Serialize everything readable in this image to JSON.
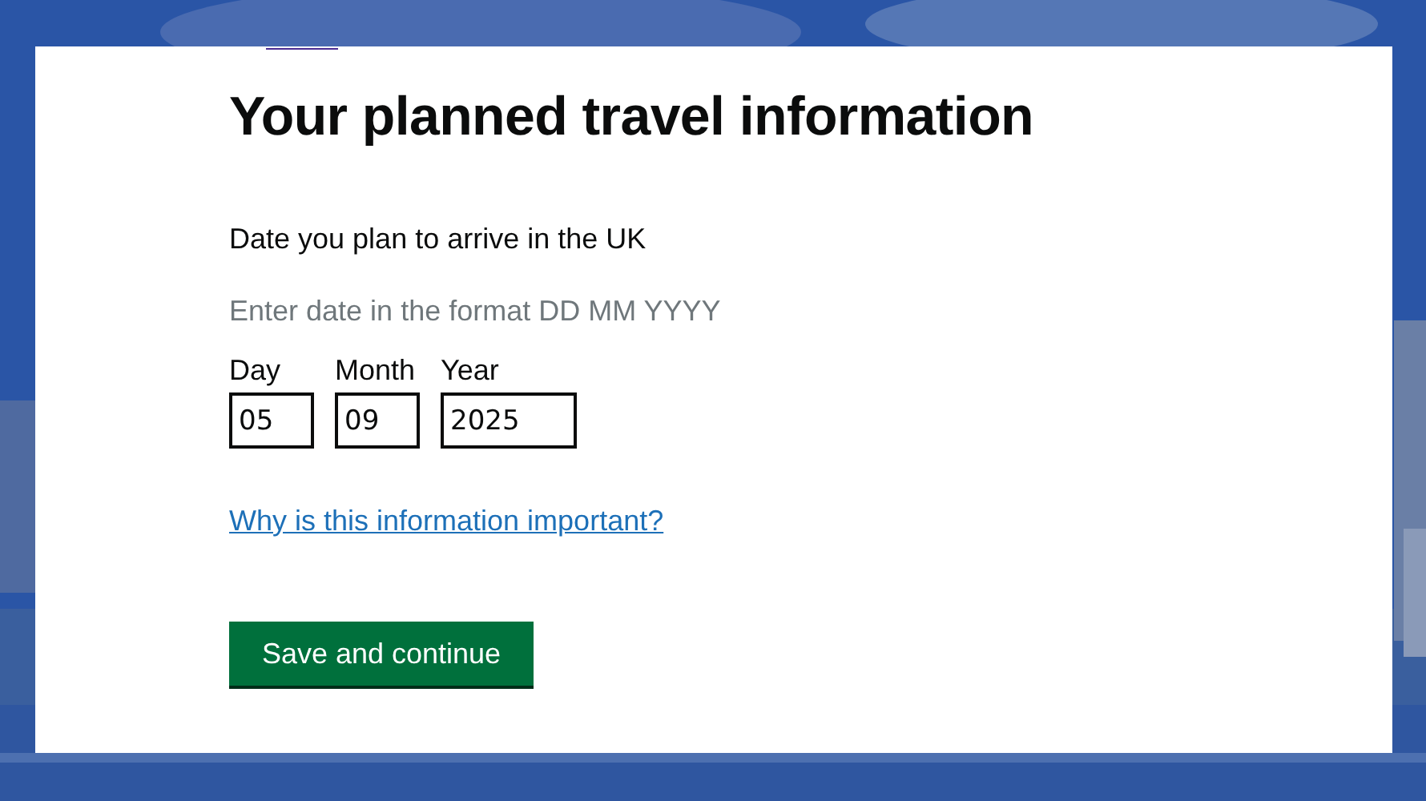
{
  "page": {
    "title": "Your planned travel information"
  },
  "date_field": {
    "label": "Date you plan to arrive in the UK",
    "hint": "Enter date in the format DD MM YYYY",
    "parts": [
      {
        "label": "Day",
        "value": "05",
        "kind": "short"
      },
      {
        "label": "Month",
        "value": "09",
        "kind": "short"
      },
      {
        "label": "Year",
        "value": "2025",
        "kind": "long"
      }
    ]
  },
  "help_link": "Why is this information important?",
  "submit_button": "Save and continue"
}
